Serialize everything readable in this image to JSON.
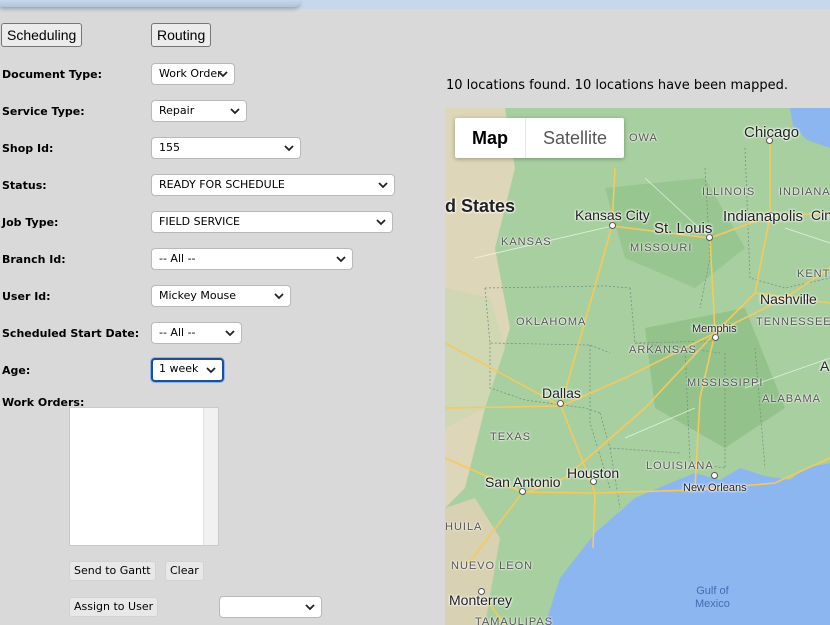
{
  "tabs": {
    "scheduling": "Scheduling",
    "routing": "Routing"
  },
  "form": {
    "document_type": {
      "label": "Document Type:",
      "value": "Work Order"
    },
    "service_type": {
      "label": "Service Type:",
      "value": "Repair"
    },
    "shop_id": {
      "label": "Shop Id:",
      "value": "155"
    },
    "status": {
      "label": "Status:",
      "value": "READY FOR SCHEDULE"
    },
    "job_type": {
      "label": "Job Type:",
      "value": "FIELD SERVICE"
    },
    "branch_id": {
      "label": "Branch Id:",
      "value": "-- All --"
    },
    "user_id": {
      "label": "User Id:",
      "value": "Mickey Mouse"
    },
    "scheduled_start": {
      "label": "Scheduled Start Date:",
      "value": "-- All --"
    },
    "age": {
      "label": "Age:",
      "value": "1 week"
    },
    "work_orders": {
      "label": "Work Orders:"
    }
  },
  "buttons": {
    "send_to_gantt": "Send to Gantt",
    "clear": "Clear",
    "assign_to_user": "Assign to User"
  },
  "assign_user_select": {
    "value": ""
  },
  "map_status": "10 locations found. 10 locations have been mapped.",
  "map": {
    "type_map": "Map",
    "type_satellite": "Satellite",
    "labels": {
      "chicago": "Chicago",
      "iowa": "OWA",
      "illinois": "ILLINOIS",
      "indiana": "INDIANA",
      "united_states": "d States",
      "kansas_city": "Kansas City",
      "st_louis": "St. Louis",
      "indianapolis": "Indianapolis",
      "cincinnati": "Cin",
      "kansas": "KANSAS",
      "missouri": "MISSOURI",
      "kentucky": "KENT",
      "nashville": "Nashville",
      "oklahoma": "OKLAHOMA",
      "memphis": "Memphis",
      "tennessee": "TENNESSEE",
      "arkansas": "ARKANSAS",
      "mississippi": "MISSISSIPPI",
      "atlanta": "A",
      "dallas": "Dallas",
      "alabama": "ALABAMA",
      "texas": "TEXAS",
      "louisiana": "LOUISIANA",
      "houston": "Houston",
      "san_antonio": "San Antonio",
      "new_orleans": "New Orleans",
      "coahuila": "HUILA",
      "nuevo_leon": "NUEVO LEON",
      "gulf": "Gulf of",
      "mexico": "Mexico",
      "monterrey": "Monterrey",
      "tamaulipas": "TAMAULIPAS"
    }
  },
  "colors": {
    "land": "#a8cf9f",
    "water": "#8cb6f0",
    "highway": "#f6c95b",
    "topbar": "#c8d8ec"
  }
}
